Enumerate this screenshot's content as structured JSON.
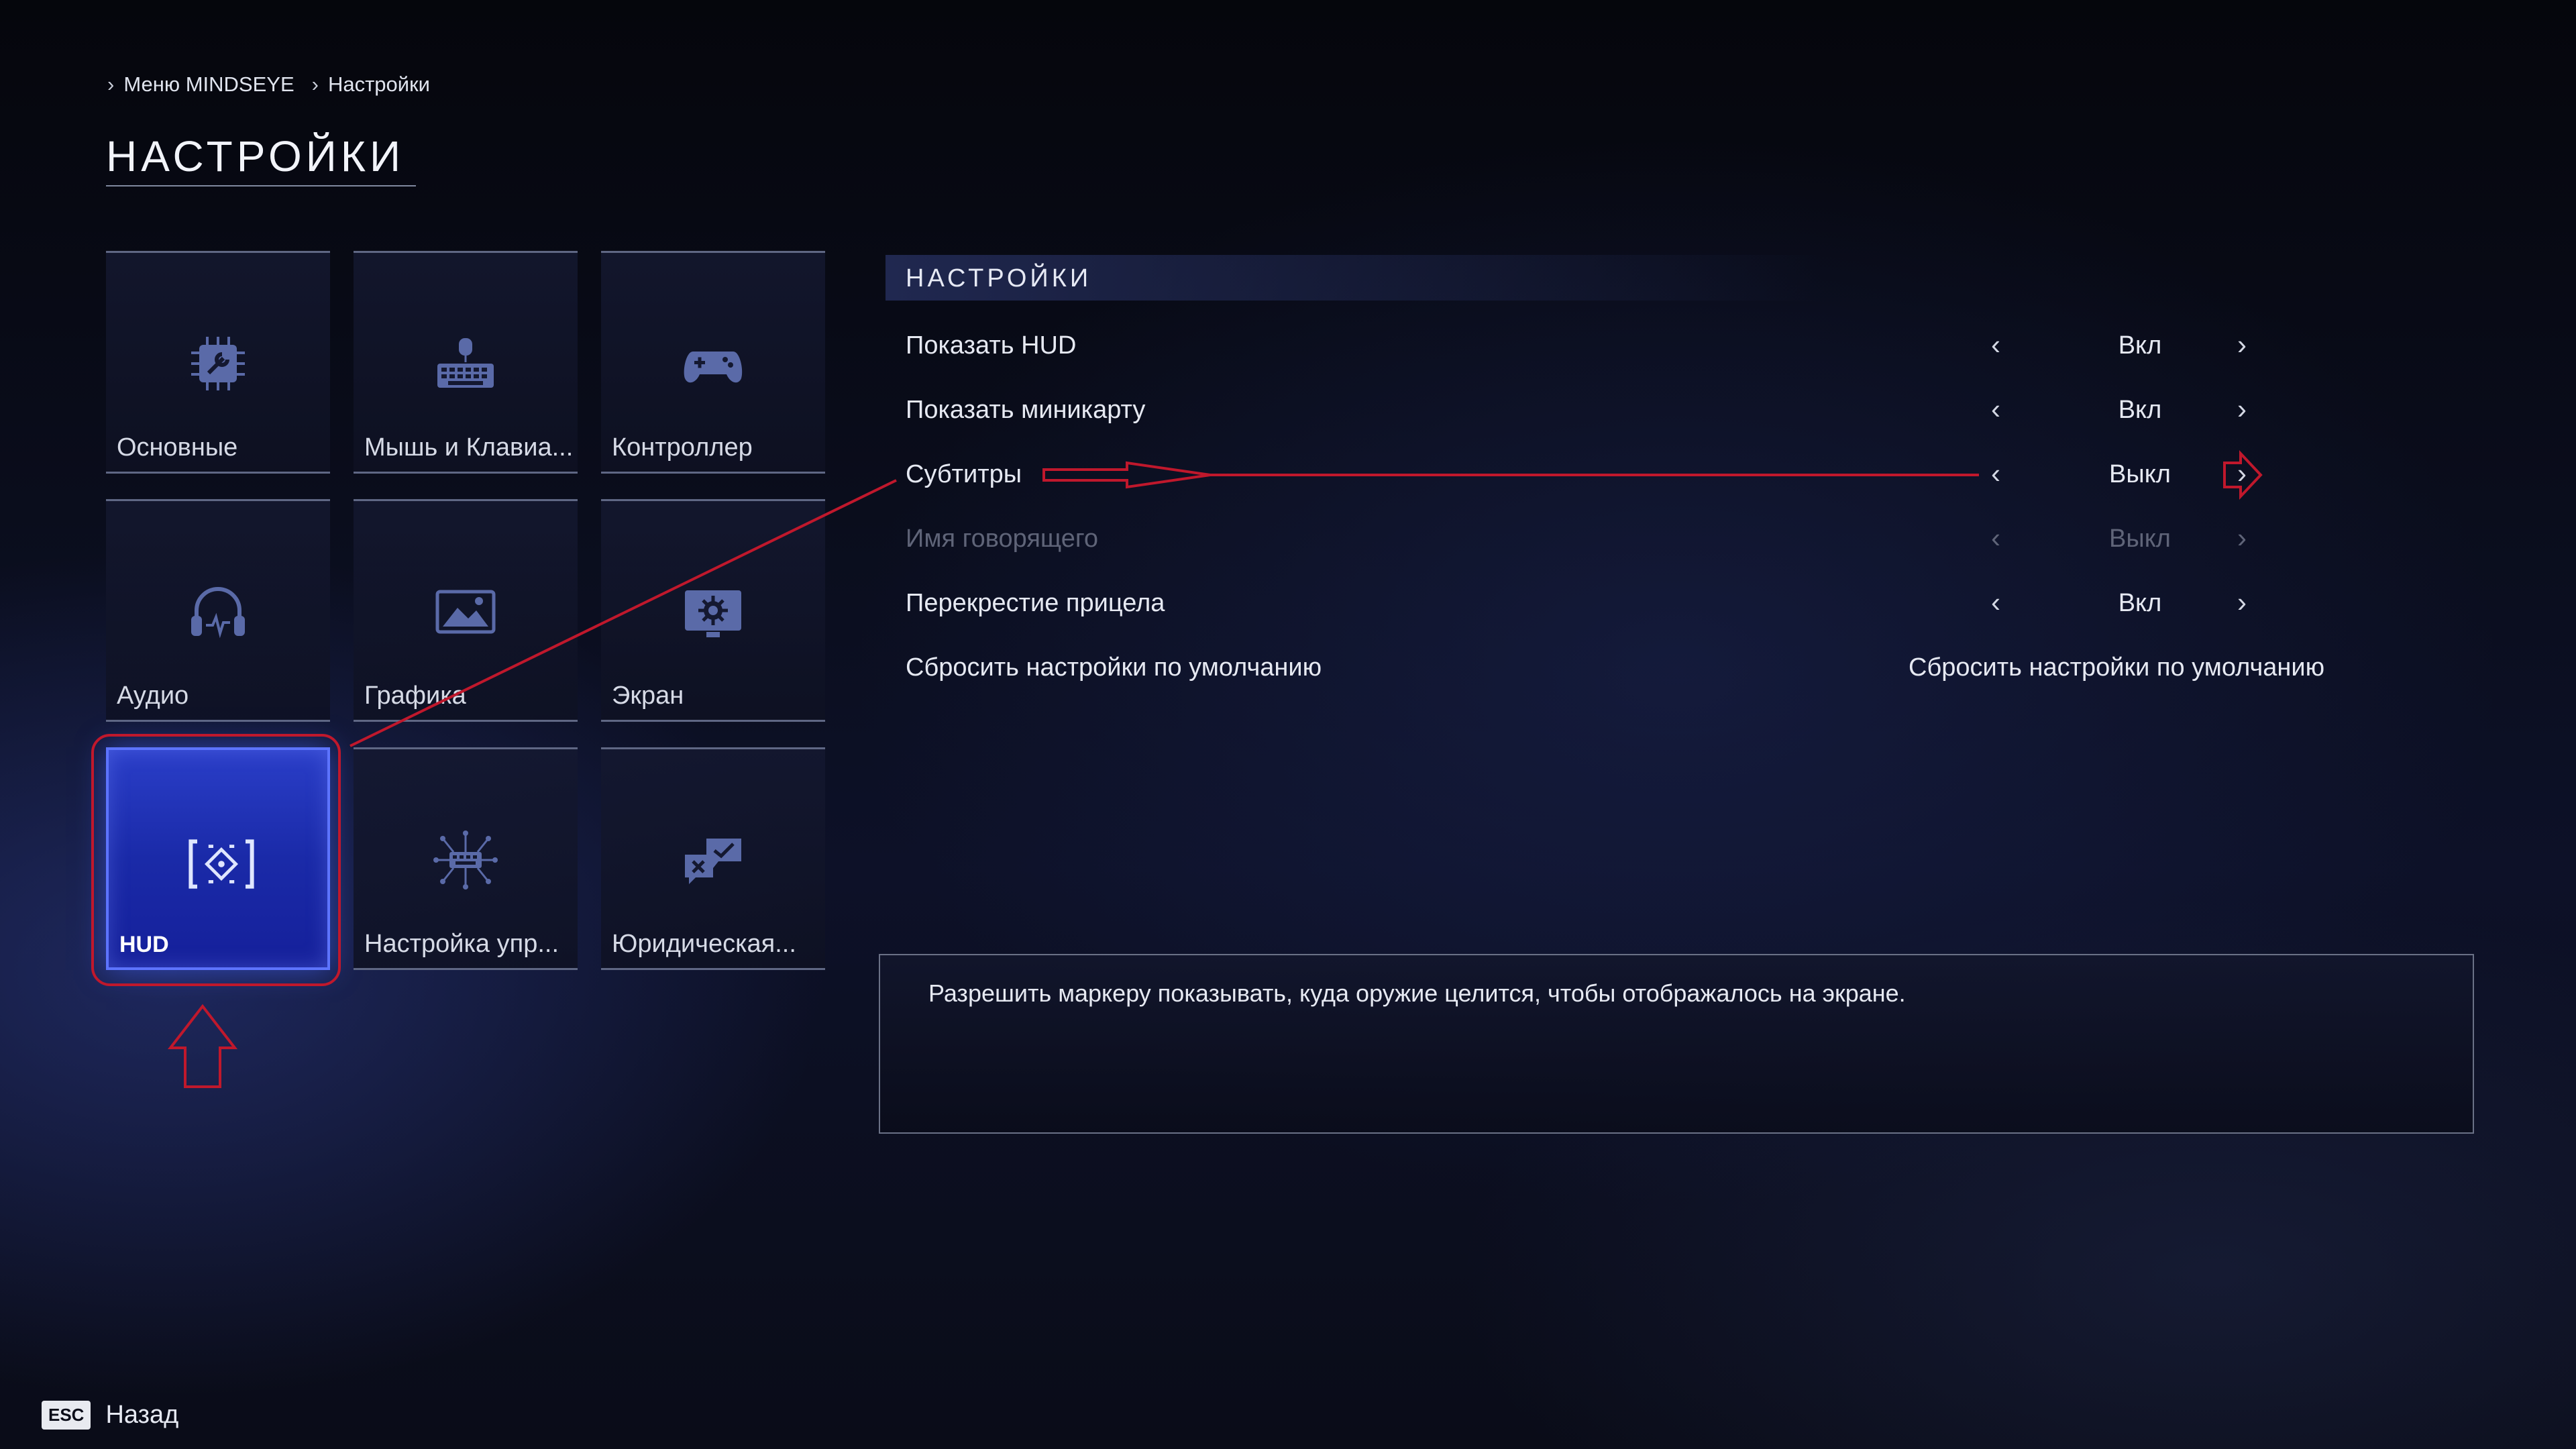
{
  "breadcrumb": {
    "items": [
      "Меню MINDSEYE",
      "Настройки"
    ]
  },
  "page_title": "НАСТРОЙКИ",
  "tiles": [
    {
      "label": "Основные",
      "icon": "settings-chip-icon"
    },
    {
      "label": "Мышь и Клавиа...",
      "icon": "keyboard-mouse-icon"
    },
    {
      "label": "Контроллер",
      "icon": "gamepad-icon"
    },
    {
      "label": "Аудио",
      "icon": "headphones-icon"
    },
    {
      "label": "Графика",
      "icon": "graphics-image-icon"
    },
    {
      "label": "Экран",
      "icon": "display-gear-icon"
    },
    {
      "label": "HUD",
      "icon": "hud-reticle-icon"
    },
    {
      "label": "Настройка упр...",
      "icon": "control-setup-icon"
    },
    {
      "label": "Юридическая...",
      "icon": "legal-checkbox-icon"
    }
  ],
  "panel": {
    "header": "НАСТРОЙКИ",
    "rows": [
      {
        "label": "Показать HUD",
        "value": "Вкл"
      },
      {
        "label": "Показать миникарту",
        "value": "Вкл"
      },
      {
        "label": "Субтитры",
        "value": "Выкл"
      },
      {
        "label": "Имя говорящего",
        "value": "Выкл"
      },
      {
        "label": "Перекрестие прицела",
        "value": "Вкл"
      }
    ],
    "reset": {
      "label": "Сбросить настройки по умолчанию",
      "action": "Сбросить настройки по умолчанию"
    },
    "prev_glyph": "‹",
    "next_glyph": "›"
  },
  "description": "Разрешить маркеру показывать, куда оружие целится, чтобы отображалось на экране.",
  "footer": {
    "key": "ESC",
    "label": "Назад"
  },
  "colors": {
    "accent": "#2a3ec8",
    "annotation": "#c0182c"
  }
}
